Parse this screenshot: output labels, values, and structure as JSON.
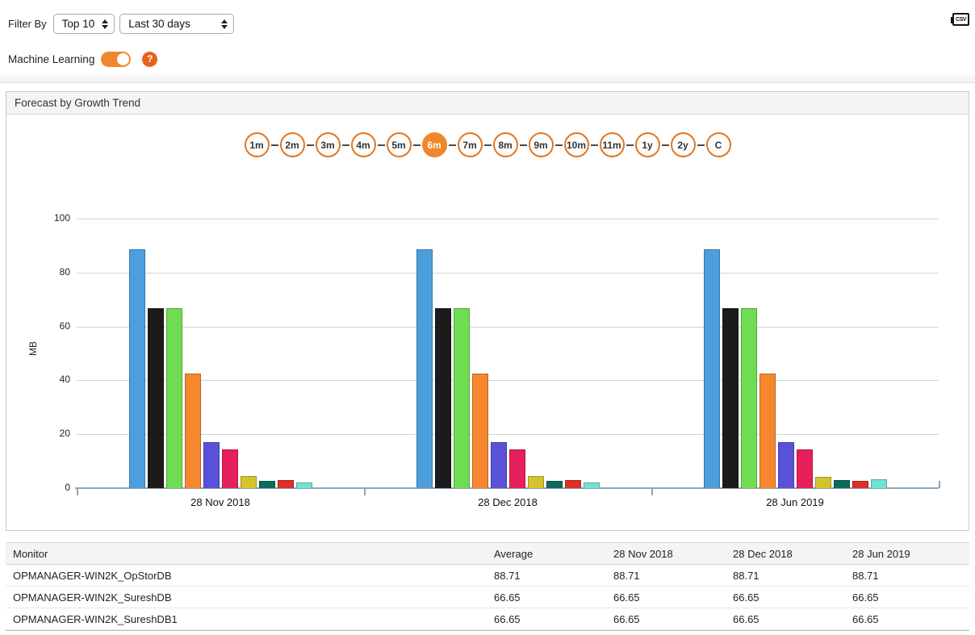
{
  "filter_bar": {
    "label": "Filter By",
    "top_n_selected": "Top 10",
    "period_selected": "Last 30 days",
    "csv_icon_label": "CSV"
  },
  "machine_learning": {
    "label": "Machine Learning",
    "toggle_state": "on",
    "help_glyph": "?"
  },
  "panel": {
    "title": "Forecast by Growth Trend"
  },
  "range_buttons": {
    "options": [
      "1m",
      "2m",
      "3m",
      "4m",
      "5m",
      "6m",
      "7m",
      "8m",
      "9m",
      "10m",
      "11m",
      "1y",
      "2y",
      "C"
    ],
    "active": "6m"
  },
  "chart_data": {
    "type": "bar",
    "title": "",
    "xlabel": "",
    "ylabel": "MB",
    "ylim": [
      0,
      100
    ],
    "yticks": [
      0,
      20,
      40,
      60,
      80,
      100
    ],
    "grid": true,
    "legend": "none",
    "categories": [
      "28 Nov 2018",
      "28 Dec 2018",
      "28 Jun 2019"
    ],
    "series": [
      {
        "name": "OPMANAGER-WIN2K_OpStorDB",
        "color": "#4d9edd",
        "values": [
          88.71,
          88.71,
          88.71
        ]
      },
      {
        "name": "OPMANAGER-WIN2K_SureshDB",
        "color": "#1b1b1b",
        "values": [
          66.65,
          66.65,
          66.65
        ]
      },
      {
        "name": "OPMANAGER-WIN2K_SureshDB1",
        "color": "#70dc52",
        "values": [
          66.65,
          66.65,
          66.65
        ]
      },
      {
        "name": "",
        "color": "#f5882f",
        "values": [
          42.5,
          42.5,
          42.5
        ]
      },
      {
        "name": "",
        "color": "#5951d8",
        "values": [
          17.0,
          17.0,
          17.0
        ]
      },
      {
        "name": "",
        "color": "#e6205a",
        "values": [
          14.5,
          14.5,
          14.5
        ]
      },
      {
        "name": "",
        "color": "#d4c32d",
        "values": [
          4.5,
          4.5,
          4.2
        ]
      },
      {
        "name": "",
        "color": "#0c6b5d",
        "values": [
          2.8,
          2.8,
          3.0
        ]
      },
      {
        "name": "",
        "color": "#e03026",
        "values": [
          2.9,
          2.9,
          2.7
        ]
      },
      {
        "name": "",
        "color": "#6fe3d3",
        "values": [
          2.2,
          2.2,
          3.3
        ]
      }
    ]
  },
  "table": {
    "columns": [
      "Monitor",
      "Average",
      "28 Nov 2018",
      "28 Dec 2018",
      "28 Jun 2019"
    ],
    "rows": [
      {
        "monitor": "OPMANAGER-WIN2K_OpStorDB",
        "values": [
          "88.71",
          "88.71",
          "88.71",
          "88.71"
        ]
      },
      {
        "monitor": "OPMANAGER-WIN2K_SureshDB",
        "values": [
          "66.65",
          "66.65",
          "66.65",
          "66.65"
        ]
      },
      {
        "monitor": "OPMANAGER-WIN2K_SureshDB1",
        "values": [
          "66.65",
          "66.65",
          "66.65",
          "66.65"
        ]
      }
    ]
  }
}
